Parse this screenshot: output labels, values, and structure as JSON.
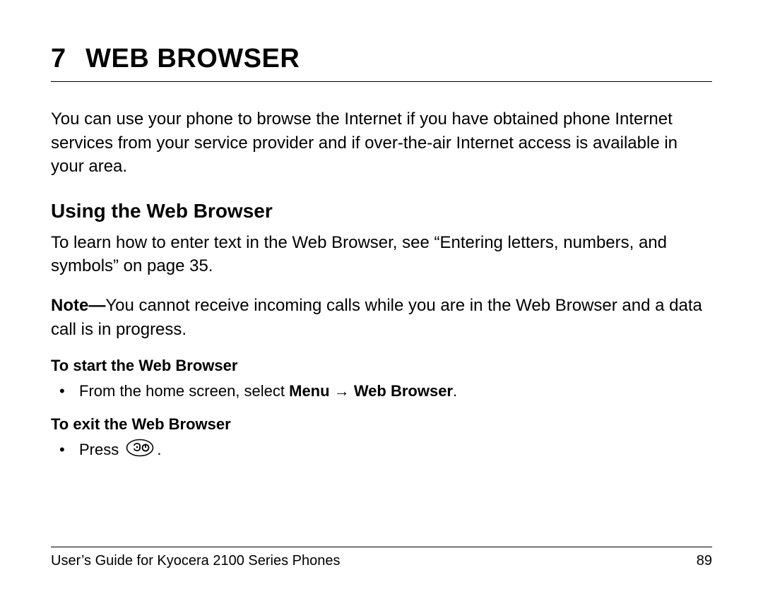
{
  "chapter": {
    "number": "7",
    "title": "Web Browser"
  },
  "intro": "You can use your phone to browse the Internet if you have obtained phone Internet services from your service provider and if over-the-air Internet access is available in your area.",
  "section": {
    "title": "Using the Web Browser",
    "para1": "To learn how to enter text in the Web Browser, see “Entering letters, numbers, and symbols” on page 35.",
    "note_label": "Note—",
    "note_text": "You cannot receive incoming calls while you are in the Web Browser and a data call is in progress."
  },
  "start": {
    "heading": "To start the Web Browser",
    "bullet_pre": "From the home screen, select ",
    "menu": "Menu",
    "arrow": " → ",
    "web": "Web Browser",
    "period": "."
  },
  "exit": {
    "heading": "To exit the Web Browser",
    "bullet_pre": "Press ",
    "period": "."
  },
  "footer": {
    "left": "User’s Guide for Kyocera 2100 Series Phones",
    "right": "89"
  }
}
